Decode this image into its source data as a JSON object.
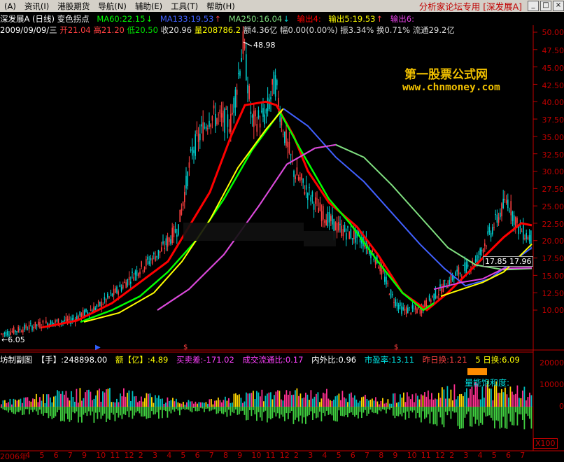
{
  "menu": {
    "items": [
      "资讯(I)",
      "港股期货",
      "导航(N)",
      "辅助(E)",
      "工具(T)",
      "帮助(H)"
    ],
    "system_glyph": "A",
    "title": "分析家论坛专用 [深发展A]"
  },
  "header": {
    "stock": "深发展A (日线) 变色拐点",
    "ma60": "MA60:22.15",
    "ma133": "MA133:19.53",
    "ma250": "MA250:16.04",
    "out4": "输出4:",
    "out5": "输出5:19.53",
    "out6": "输出6:"
  },
  "quote": {
    "date": "2009/09/09/三",
    "open": "开21.04",
    "high": "高21.20",
    "low": "低20.50",
    "close": "收20.96",
    "volume": "量208786.2",
    "amount": "额4.36亿",
    "change": "幅0.00(0.00%)",
    "amplitude": "振3.34%",
    "turnover": "换0.71%",
    "float": "流通29.2亿"
  },
  "watermark": {
    "line1": "第一股票公式网",
    "line2": "www.chnmoney.com"
  },
  "annotations": {
    "peak": "48.98",
    "low": "6.05",
    "ma_box": "17.85 17.96"
  },
  "price_axis": [
    "50.00",
    "47.50",
    "45.00",
    "42.50",
    "40.00",
    "37.50",
    "35.00",
    "32.50",
    "30.00",
    "27.50",
    "25.00",
    "22.50",
    "20.00",
    "17.50",
    "15.00",
    "12.50",
    "10.00"
  ],
  "indicator": {
    "name": "坊制副图",
    "shou": "【手】:248898.00",
    "yi": "额【亿】:4.89",
    "mmc": "买卖差:-171.02",
    "cjlt": "成交流通比:0.17",
    "nwb": "内外比:0.96",
    "syl": "市盈率:13.11",
    "zrh": "昨日换:1.21",
    "rh5": "5 日换:6.09",
    "energy": "量能饱和度:",
    "axis": [
      "20000",
      "10000",
      "0"
    ],
    "zoom": "X100"
  },
  "time_axis": [
    "2006年",
    "4",
    "5",
    "6",
    "7",
    "9",
    "10",
    "11",
    "12",
    "2",
    "3",
    "4",
    "5",
    "6",
    "7",
    "8",
    "9",
    "10",
    "11",
    "12",
    "2",
    "3",
    "4",
    "5",
    "6",
    "7",
    "8",
    "9",
    "10",
    "11",
    "12",
    "2",
    "3",
    "4",
    "5",
    "6",
    "7"
  ],
  "colors": {
    "up": "#ff4040",
    "down": "#00d0d0",
    "ma_red": "#ff0000",
    "ma_yellow": "#ffff00",
    "ma_green": "#00ff00",
    "ma_blue": "#4060ff",
    "ma_magenta": "#e040e0",
    "ma_lightgreen": "#80e080",
    "axis": "#c00000"
  }
}
